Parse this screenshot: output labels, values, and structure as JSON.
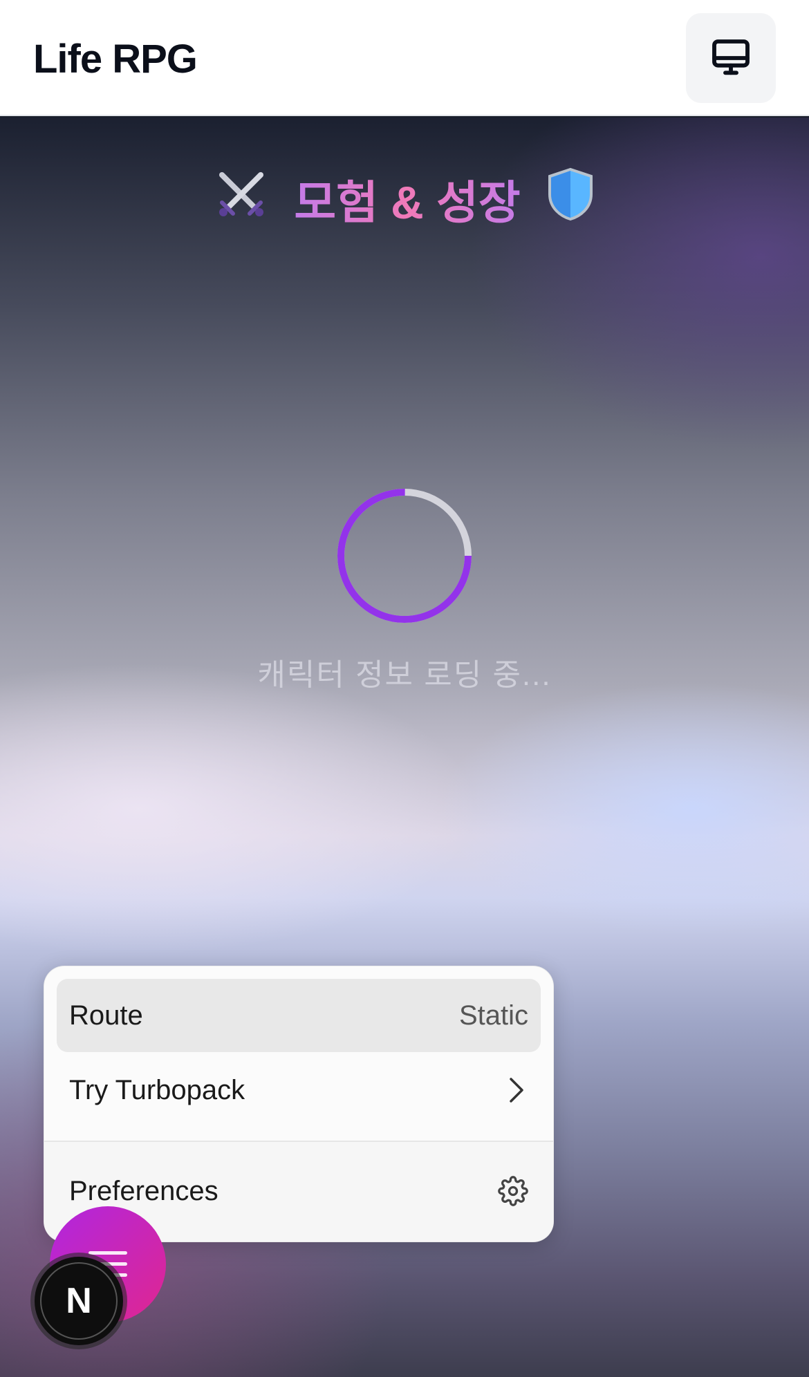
{
  "header": {
    "app_title": "Life RPG",
    "device_icon": "monitor-icon"
  },
  "hero": {
    "left_icon": "crossed-swords-icon",
    "title": "모험 & 성장",
    "right_icon": "shield-icon"
  },
  "loading": {
    "text": "캐릭터 정보 로딩 중...",
    "spinner_color": "#9333ea"
  },
  "dev_menu": {
    "items": [
      {
        "label": "Route",
        "value": "Static"
      },
      {
        "label": "Try Turbopack",
        "icon": "chevron-right-icon"
      },
      {
        "label": "Preferences",
        "icon": "gear-icon"
      }
    ]
  },
  "fab": {
    "icon": "menu-icon",
    "color": "#c026d3"
  },
  "next_badge": {
    "letter": "N"
  }
}
